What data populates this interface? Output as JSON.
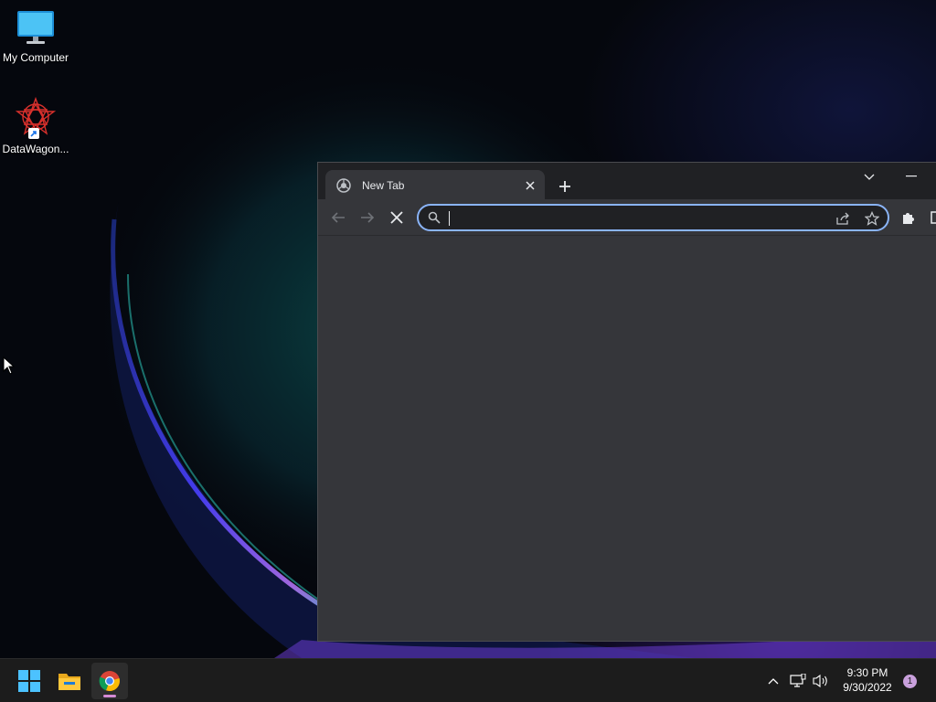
{
  "desktop": {
    "icons": [
      {
        "label": "My Computer",
        "icon": "monitor-icon"
      },
      {
        "label": "DataWagon...",
        "icon": "datawagon-app-icon"
      }
    ]
  },
  "browser": {
    "tab": {
      "title": "New Tab",
      "favicon": "chrome-newtab-icon"
    },
    "omnibox": {
      "value": "",
      "placeholder": ""
    },
    "colors": {
      "frame": "#202124",
      "toolbar": "#35363a",
      "focus_ring": "#8ab4f8",
      "content": "#35363a"
    }
  },
  "taskbar": {
    "apps": [
      "windows-start-icon",
      "file-explorer-icon",
      "chrome-icon"
    ],
    "clock": {
      "time": "9:30 PM",
      "date": "9/30/2022"
    },
    "notification_count": "1"
  }
}
